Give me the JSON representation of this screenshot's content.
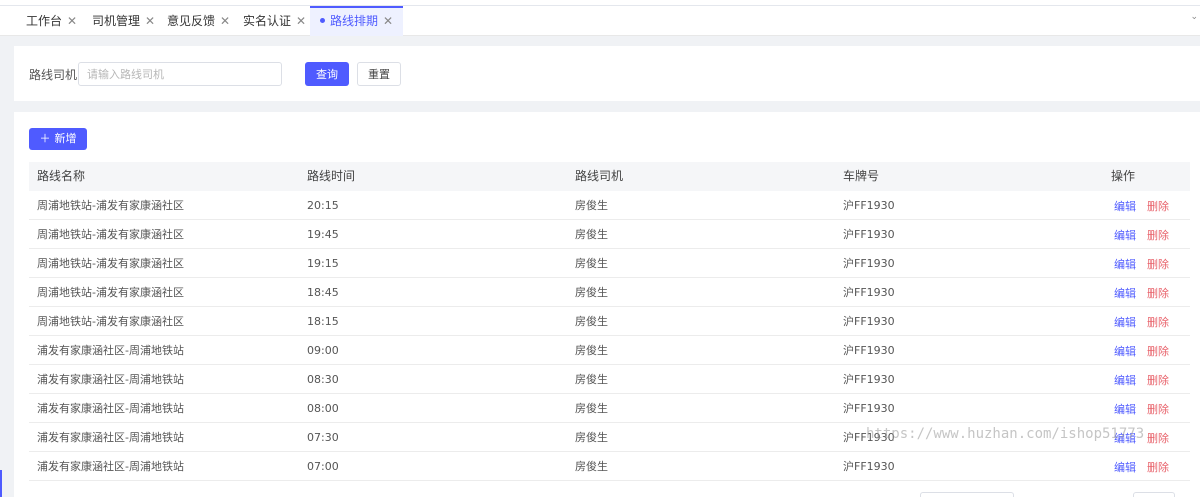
{
  "tabs": [
    {
      "label": "工作台"
    },
    {
      "label": "司机管理"
    },
    {
      "label": "意见反馈"
    },
    {
      "label": "实名认证"
    },
    {
      "label": "路线排期"
    }
  ],
  "search": {
    "label": "路线司机",
    "placeholder": "请输入路线司机",
    "query_button": "查询",
    "reset_button": "重置"
  },
  "toolbar": {
    "add_button": "新增"
  },
  "table": {
    "columns": [
      "路线名称",
      "路线时间",
      "路线司机",
      "车牌号",
      "操作"
    ],
    "rows": [
      {
        "route": "周浦地铁站-浦发有家康涵社区",
        "time": "20:15",
        "driver": "房俊生",
        "plate": "沪FF1930"
      },
      {
        "route": "周浦地铁站-浦发有家康涵社区",
        "time": "19:45",
        "driver": "房俊生",
        "plate": "沪FF1930"
      },
      {
        "route": "周浦地铁站-浦发有家康涵社区",
        "time": "19:15",
        "driver": "房俊生",
        "plate": "沪FF1930"
      },
      {
        "route": "周浦地铁站-浦发有家康涵社区",
        "time": "18:45",
        "driver": "房俊生",
        "plate": "沪FF1930"
      },
      {
        "route": "周浦地铁站-浦发有家康涵社区",
        "time": "18:15",
        "driver": "房俊生",
        "plate": "沪FF1930"
      },
      {
        "route": "浦发有家康涵社区-周浦地铁站",
        "time": "09:00",
        "driver": "房俊生",
        "plate": "沪FF1930"
      },
      {
        "route": "浦发有家康涵社区-周浦地铁站",
        "time": "08:30",
        "driver": "房俊生",
        "plate": "沪FF1930"
      },
      {
        "route": "浦发有家康涵社区-周浦地铁站",
        "time": "08:00",
        "driver": "房俊生",
        "plate": "沪FF1930"
      },
      {
        "route": "浦发有家康涵社区-周浦地铁站",
        "time": "07:30",
        "driver": "房俊生",
        "plate": "沪FF1930"
      },
      {
        "route": "浦发有家康涵社区-周浦地铁站",
        "time": "07:00",
        "driver": "房俊生",
        "plate": "沪FF1930"
      }
    ],
    "action_edit": "编辑",
    "action_delete": "删除"
  },
  "watermark": "https://www.huzhan.com/ishop51773",
  "colors": {
    "primary": "#4f5bff",
    "danger": "#e8616a"
  }
}
